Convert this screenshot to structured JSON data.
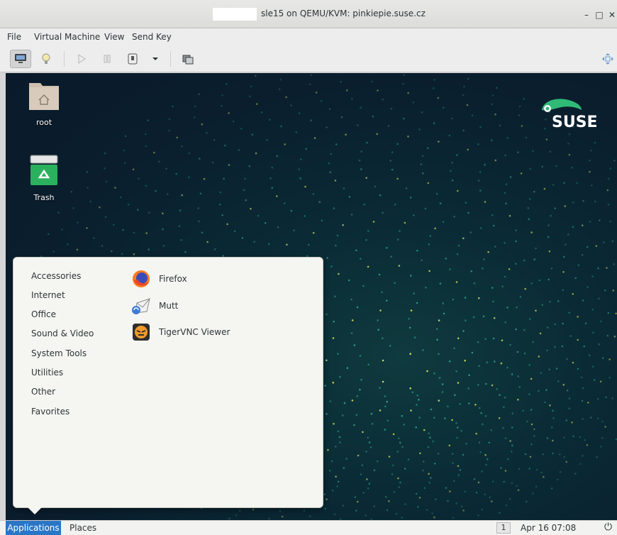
{
  "window": {
    "title": "sle15 on QEMU/KVM: pinkiepie.suse.cz",
    "controls": [
      "minimize-icon",
      "maximize-icon",
      "close-icon"
    ]
  },
  "menubar": {
    "items": [
      "File",
      "Virtual Machine",
      "View",
      "Send Key"
    ]
  },
  "toolbar": {
    "buttons": [
      "console-icon",
      "lightbulb-icon",
      "play-icon",
      "pause-icon",
      "power-icon",
      "chevron-down-icon",
      "screenshot-icon",
      "fullscreen-icon"
    ]
  },
  "desktop": {
    "icons": [
      {
        "label": "root",
        "icon": "home-folder-icon"
      },
      {
        "label": "Trash",
        "icon": "trash-icon"
      }
    ],
    "logo": "SUSE"
  },
  "app_menu": {
    "categories": [
      "Accessories",
      "Internet",
      "Office",
      "Sound & Video",
      "System Tools",
      "Utilities",
      "Other",
      "Favorites"
    ],
    "apps": [
      {
        "label": "Firefox",
        "icon": "firefox-icon"
      },
      {
        "label": "Mutt",
        "icon": "mutt-icon"
      },
      {
        "label": "TigerVNC Viewer",
        "icon": "tigervnc-icon"
      }
    ]
  },
  "panel": {
    "applications": "Applications",
    "places": "Places",
    "workspace": "1",
    "clock": "Apr 16 07:08"
  },
  "colors": {
    "accent": "#2a76c6",
    "desktop_bg": "#0a1e2e",
    "suse_green": "#30ba78"
  }
}
